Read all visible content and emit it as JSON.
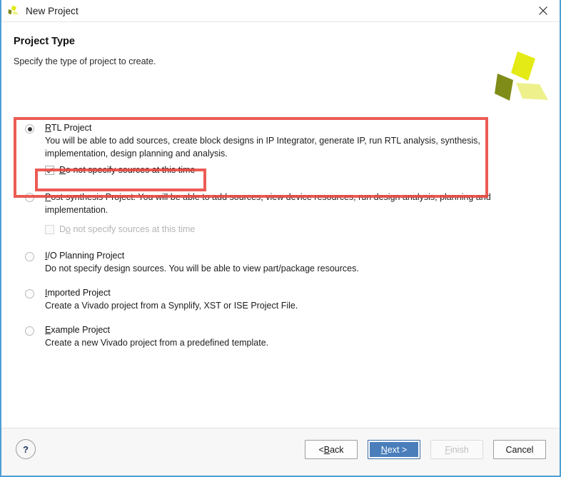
{
  "window": {
    "title": "New Project",
    "icon": "vivado-logo-icon",
    "close_label": "×",
    "accent_border": "#4d9fd4"
  },
  "header": {
    "title": "Project Type",
    "subtitle": "Specify the type of project to create.",
    "logo": "vivado-logo"
  },
  "options": [
    {
      "id": "rtl-project",
      "mnemonic": "R",
      "label_rest": "TL Project",
      "selected": true,
      "description": "You will be able to add sources, create block designs in IP Integrator, generate IP, run RTL analysis, synthesis, implementation, design planning and analysis.",
      "checkbox": {
        "mnemonic": "D",
        "label_rest": "o not specify sources at this time",
        "checked": true,
        "enabled": true
      }
    },
    {
      "id": "post-synthesis-project",
      "mnemonic": "P",
      "label_rest": "ost-synthesis Project: You will be able to add sources, view device resources, run design analysis, planning and implementation.",
      "selected": false,
      "inline_description": true,
      "checkbox": {
        "prefix": "D",
        "mnemonic": "o",
        "label_rest": " not specify sources at this time",
        "checked": false,
        "enabled": false
      }
    },
    {
      "id": "io-planning-project",
      "mnemonic": "I",
      "label_rest": "/O Planning Project",
      "selected": false,
      "description": "Do not specify design sources. You will be able to view part/package resources."
    },
    {
      "id": "imported-project",
      "mnemonic": "I",
      "label_rest": "mported Project",
      "selected": false,
      "description": "Create a Vivado project from a Synplify, XST or ISE Project File."
    },
    {
      "id": "example-project",
      "mnemonic": "E",
      "label_rest": "xample Project",
      "selected": false,
      "description": "Create a new Vivado project from a predefined template."
    }
  ],
  "annotations": {
    "color": "#e8453c",
    "outer_target": "rtl-project-option",
    "inner_target": "rtl-do-not-specify-sources-checkbox"
  },
  "footer": {
    "help_label": "?",
    "buttons": [
      {
        "id": "back",
        "prefix": "< ",
        "mnemonic": "B",
        "suffix": "ack",
        "state": "normal"
      },
      {
        "id": "next",
        "prefix": "",
        "mnemonic": "N",
        "suffix": "ext >",
        "state": "primary"
      },
      {
        "id": "finish",
        "prefix": "",
        "mnemonic": "F",
        "suffix": "inish",
        "state": "disabled"
      },
      {
        "id": "cancel",
        "prefix": "",
        "mnemonic": "",
        "suffix": "Cancel",
        "state": "normal"
      }
    ]
  }
}
